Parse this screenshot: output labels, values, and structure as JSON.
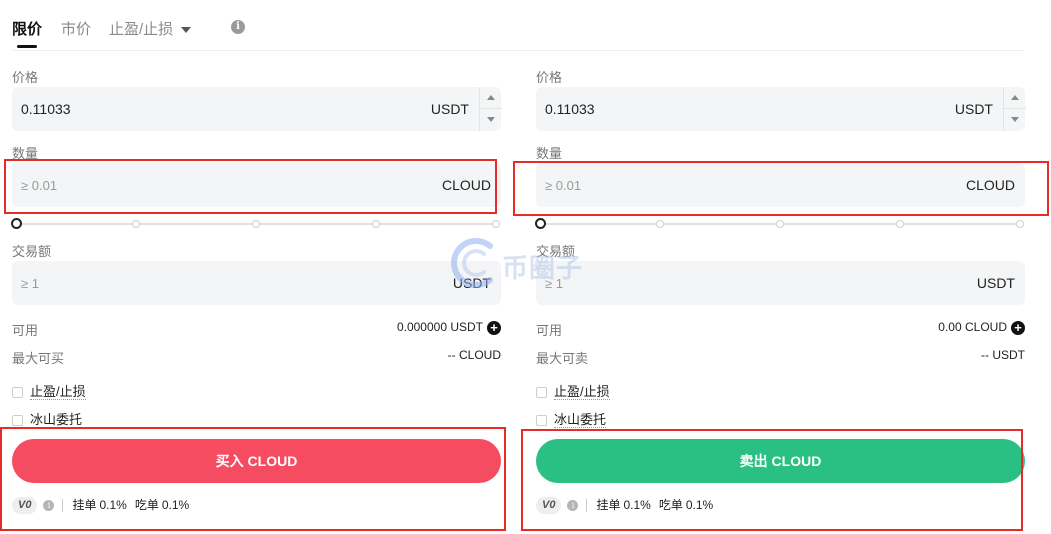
{
  "tabs": [
    {
      "label": "限价"
    },
    {
      "label": "市价"
    },
    {
      "label": "止盈/止损"
    }
  ],
  "buy": {
    "price_label": "价格",
    "price_value": "0.11033",
    "price_unit": "USDT",
    "qty_label": "数量",
    "qty_placeholder": "≥ 0.01",
    "qty_unit": "CLOUD",
    "amount_label": "交易额",
    "amount_placeholder": "≥ 1",
    "amount_unit": "USDT",
    "available_label": "可用",
    "available_value": "0.000000 USDT",
    "max_label": "最大可买",
    "max_value": "-- CLOUD",
    "tpsl_label": "止盈/止损",
    "iceberg_label": "冰山委托",
    "button_label": "买入 CLOUD",
    "vip_level": "V0",
    "maker_label": "挂单",
    "maker_fee": "0.1%",
    "taker_label": "吃单",
    "taker_fee": "0.1%"
  },
  "sell": {
    "price_label": "价格",
    "price_value": "0.11033",
    "price_unit": "USDT",
    "qty_label": "数量",
    "qty_placeholder": "≥ 0.01",
    "qty_unit": "CLOUD",
    "amount_label": "交易额",
    "amount_placeholder": "≥ 1",
    "amount_unit": "USDT",
    "available_label": "可用",
    "available_value": "0.00 CLOUD",
    "max_label": "最大可卖",
    "max_value": "-- USDT",
    "tpsl_label": "止盈/止损",
    "iceberg_label": "冰山委托",
    "button_label": "卖出 CLOUD",
    "vip_level": "V0",
    "maker_label": "挂单",
    "maker_fee": "0.1%",
    "taker_label": "吃单",
    "taker_fee": "0.1%"
  },
  "slider_value": 0,
  "watermark_text": "币圈子",
  "colors": {
    "buy": "#f64c62",
    "sell": "#2ac083",
    "highlight_box": "#e52d27"
  }
}
